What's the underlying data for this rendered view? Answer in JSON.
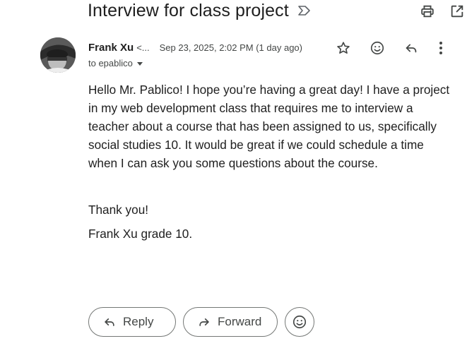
{
  "subject": "Interview for class project",
  "icons": {
    "label": "label-arrow-icon",
    "print": "print-icon",
    "open_new_window": "open-in-new-icon",
    "star": "star-icon",
    "emoji": "emoji-icon",
    "reply": "reply-icon",
    "more": "more-vertical-icon",
    "forward": "forward-icon"
  },
  "message": {
    "sender_name": "Frank Xu",
    "sender_email_truncated": "<...",
    "date": "Sep 23, 2025, 2:02 PM (1 day ago)",
    "to": "to epablico",
    "body_paragraph": "Hello Mr. Pablico! I hope you’re having a great day! I have a project in my web development class that requires me to interview a teacher about a course that has been assigned to us, specifically social studies 10. It would be great if we could schedule a time when I can ask you some questions about the course.",
    "closing": "Thank you!",
    "signature": "Frank Xu grade 10."
  },
  "actions": {
    "reply_label": "Reply",
    "forward_label": "Forward"
  },
  "colors": {
    "text": "#1f1f1f",
    "secondary_text": "#444746",
    "border": "#747775"
  }
}
